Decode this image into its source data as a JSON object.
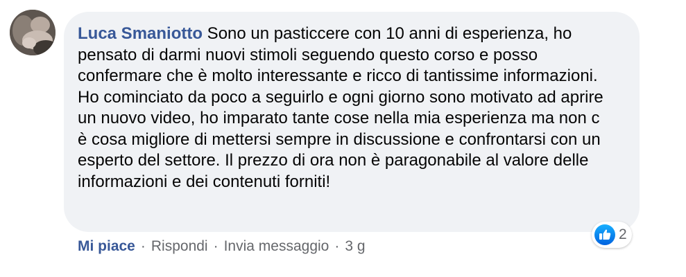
{
  "comment": {
    "author": "Luca Smaniotto",
    "text": " Sono un pasticcere con 10 anni di esperienza, ho pensato di darmi nuovi stimoli seguendo questo corso e posso confermare che è molto interessante e ricco di tantissime informazioni. Ho cominciato da poco a seguirlo e ogni giorno sono motivato ad aprire un nuovo video, ho imparato tante cose nella mia esperienza ma non c è cosa migliore di mettersi sempre in discussione e confrontarsi con un esperto del settore. Il prezzo di ora non è paragonabile al valore delle informazioni e dei contenuti forniti!"
  },
  "reactions": {
    "icon": "like-icon",
    "count": "2",
    "color": "#1877f2"
  },
  "actions": {
    "like": "Mi piace",
    "reply": "Rispondi",
    "message": "Invia messaggio",
    "time": "3 g",
    "separator": "·"
  },
  "colors": {
    "bubble": "#f0f2f5",
    "author": "#385898",
    "meta": "#65676b"
  }
}
